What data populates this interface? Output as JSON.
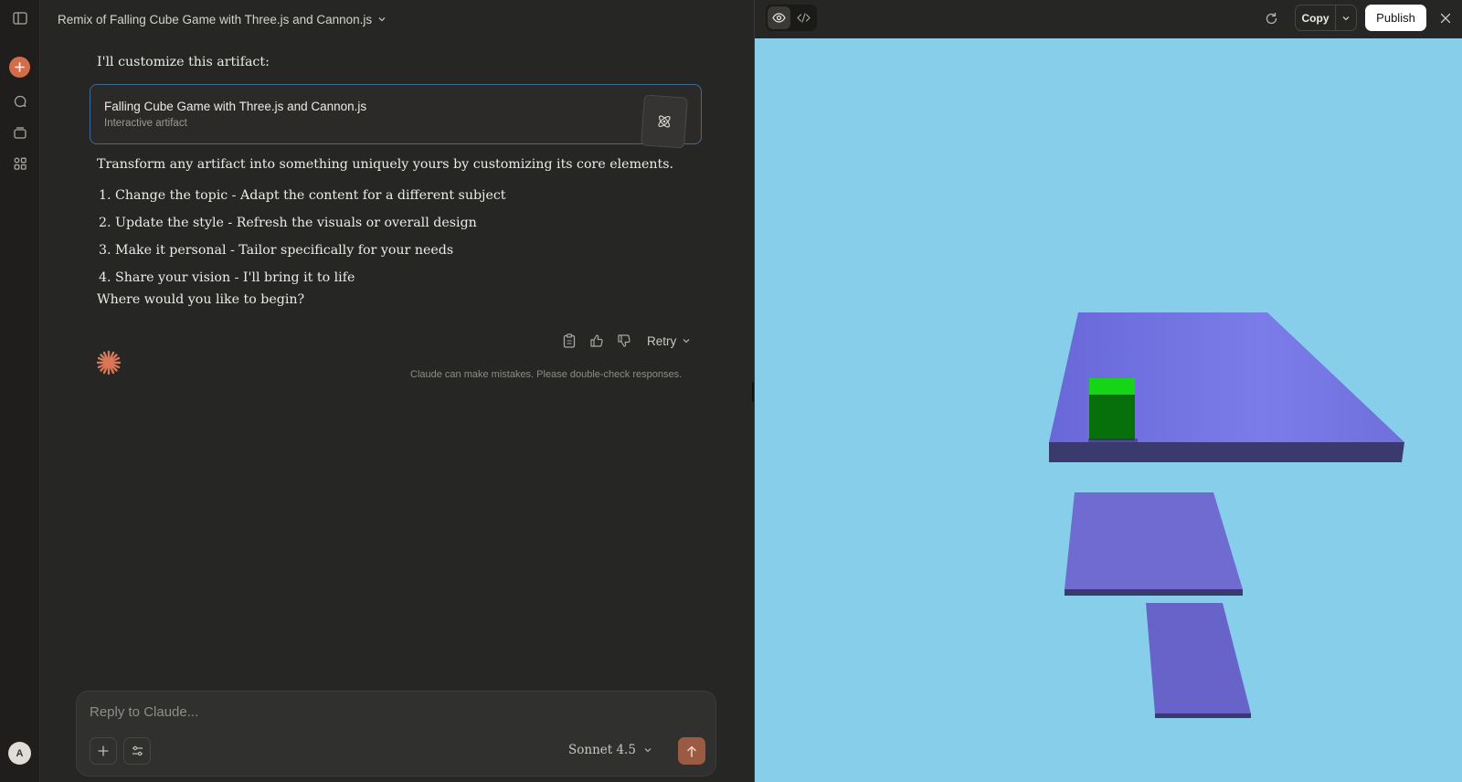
{
  "app": {
    "chat_title": "Remix of Falling Cube Game with Three.js and Cannon.js"
  },
  "message": {
    "intro": "I'll customize this artifact:",
    "artifact_card": {
      "title": "Falling Cube Game with Three.js and Cannon.js",
      "subtitle": "Interactive artifact"
    },
    "body": "Transform any artifact into something uniquely yours by customizing its core elements.",
    "list": [
      "1. Change the topic - Adapt the content for a different subject",
      "2. Update the style - Refresh the visuals or overall design",
      "3. Make it personal - Tailor specifically for your needs",
      "4. Share your vision - I'll bring it to life"
    ],
    "closing": "Where would you like to begin?",
    "retry_label": "Retry",
    "disclaimer": "Claude can make mistakes. Please double-check responses."
  },
  "composer": {
    "placeholder": "Reply to Claude...",
    "model": "Sonnet 4.5"
  },
  "sidebar": {
    "avatar_initial": "A"
  },
  "preview": {
    "copy_label": "Copy",
    "publish_label": "Publish"
  },
  "colors": {
    "accent": "#d36c4a",
    "canvas_sky": "#87ceeb",
    "platform": "#7b7bea",
    "cube": "#00c000"
  }
}
